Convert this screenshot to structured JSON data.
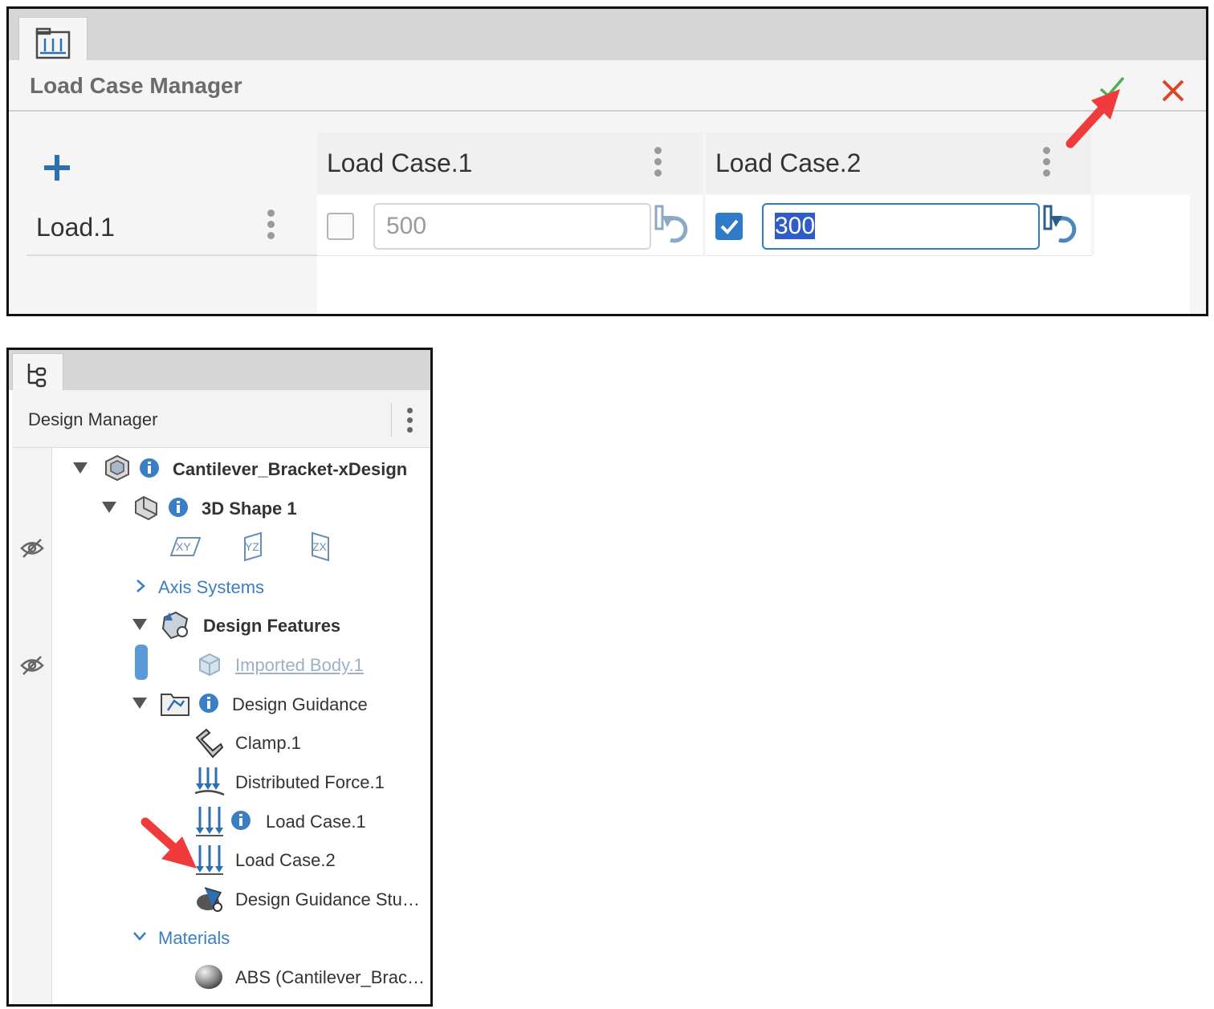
{
  "load_case_manager": {
    "title": "Load Case Manager",
    "tab_icon": "load-case-manager-icon",
    "columns": [
      {
        "label": "Load Case.1"
      },
      {
        "label": "Load Case.2"
      }
    ],
    "rows": [
      {
        "label": "Load.1",
        "cells": [
          {
            "checked": false,
            "value": "500"
          },
          {
            "checked": true,
            "value": "300"
          }
        ]
      }
    ],
    "colors": {
      "accent": "#2e7cc9",
      "ok": "#4caf50",
      "close": "#d9472b",
      "arrow": "#ef3b3b"
    }
  },
  "design_manager": {
    "title": "Design Manager",
    "tab_icon": "tree-icon",
    "tree": {
      "root": "Cantilever_Bracket-xDesign",
      "shape": "3D Shape 1",
      "planes": [
        "XY",
        "YZ",
        "ZX"
      ],
      "axis_systems": "Axis Systems",
      "design_features": "Design Features",
      "imported_body": "Imported Body.1",
      "design_guidance": "Design Guidance",
      "clamp": "Clamp.1",
      "distributed_force": "Distributed Force.1",
      "load_case_1": "Load Case.1",
      "load_case_2": "Load Case.2",
      "study": "Design Guidance Stu…",
      "materials": "Materials",
      "material": "ABS (Cantilever_Brac…"
    }
  }
}
